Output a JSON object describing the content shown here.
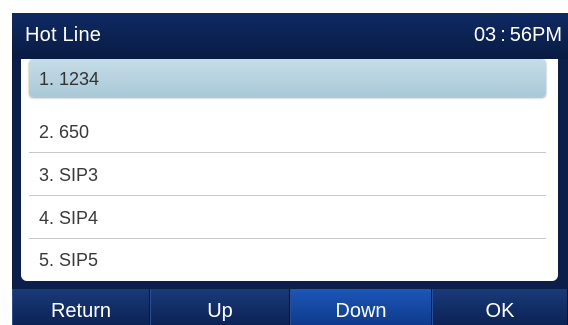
{
  "header": {
    "title": "Hot Line",
    "time": "03 : 56PM"
  },
  "list": {
    "items": [
      {
        "label": "1. 1234",
        "selected": true
      },
      {
        "label": "2. 650",
        "selected": false
      },
      {
        "label": "3. SIP3",
        "selected": false
      },
      {
        "label": "4. SIP4",
        "selected": false
      },
      {
        "label": "5. SIP5",
        "selected": false
      }
    ]
  },
  "softkeys": [
    {
      "label": "Return"
    },
    {
      "label": "Up"
    },
    {
      "label": "Down"
    },
    {
      "label": "OK"
    }
  ],
  "colors": {
    "screen_background": "#0b1f4a",
    "selection_highlight": "#b6d1dd",
    "softkey_background": "#0b2256",
    "softkey_active": "#1d57b8"
  }
}
